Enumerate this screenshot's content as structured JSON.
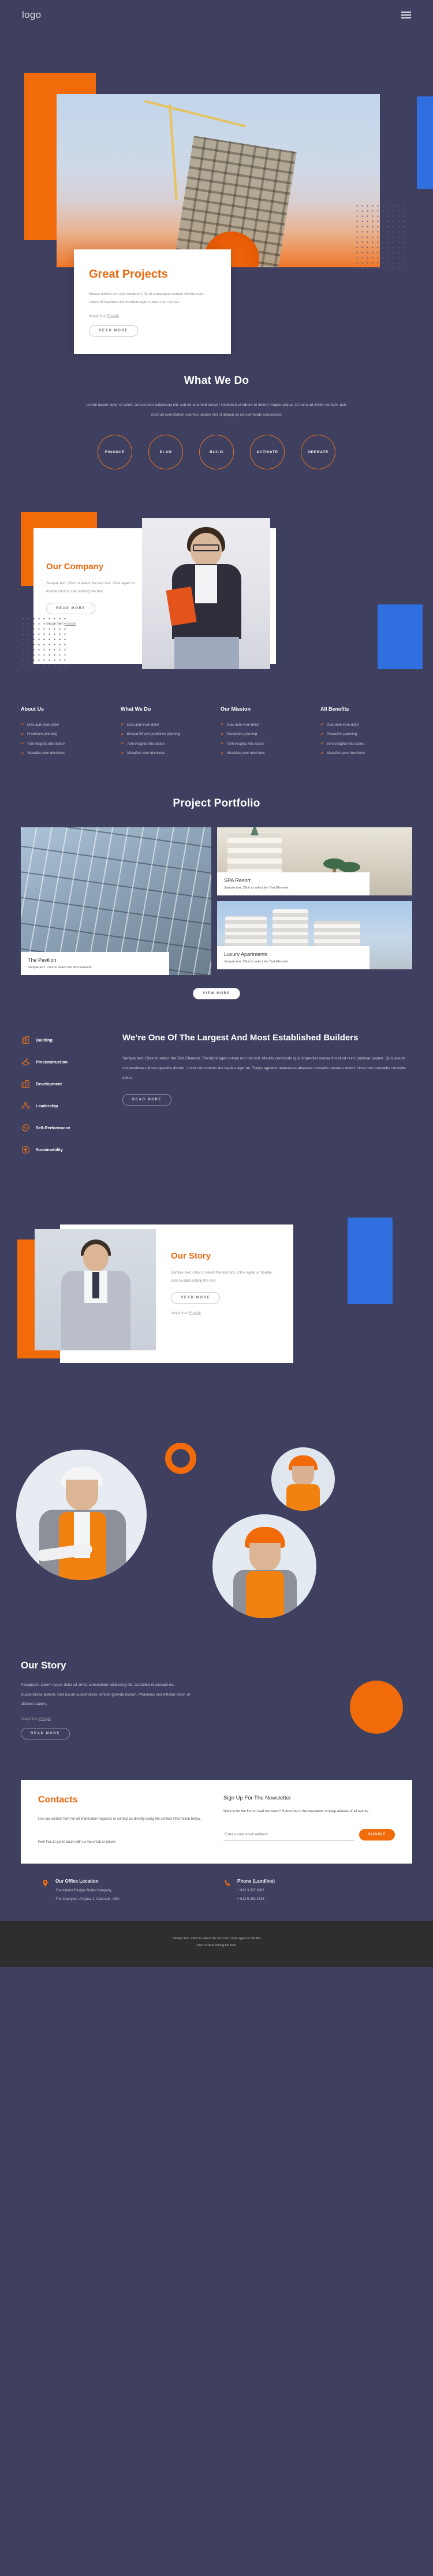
{
  "header": {
    "logo": "logo",
    "menu_icon": "hamburger-menu-icon"
  },
  "hero": {
    "title": "Great Projects",
    "body": "Massa ultricies mi quis hendrerit. Ac ut consequat semper viverra nam. Libero id faucibus nisl tincidunt eget nullam non nisi est.",
    "credit_prefix": "Image from ",
    "credit_link": "Freepik",
    "cta": "READ MORE"
  },
  "what_we_do": {
    "title": "What We Do",
    "subtitle": "Lorem ipsum dolor sit amet, consectetur adipiscing elit, sed do eiusmod tempor incididunt ut labore et dolore magna aliqua. Ut enim ad minim veniam, quis nostrud exercitation ullamco laboris nisi ut aliquip ex ea commodo consequat.",
    "steps": [
      "FINANCE",
      "PLAN",
      "BUILD",
      "ACTIVATE",
      "OPERATE"
    ]
  },
  "company": {
    "title": "Our Company",
    "body": "Sample text. Click to select the text box. Click again or double click to start editing the text.",
    "cta": "READ MORE",
    "credit_prefix": "Image from ",
    "credit_link": "Freepik"
  },
  "columns": [
    {
      "title": "About Us",
      "items": [
        "Duis aute irure dolor",
        "Predictive planning",
        "Turn insights into action",
        "Visualize your decisions"
      ]
    },
    {
      "title": "What We Do",
      "items": [
        "Duis aute irure dolor",
        "Embed BI and predictive planning",
        "Turn insights into action",
        "Visualize your decisions"
      ]
    },
    {
      "title": "Our Mission",
      "items": [
        "Duis aute irure dolor",
        "Predictive planning",
        "Turn insights into action",
        "Visualize your decisions"
      ]
    },
    {
      "title": "All Benefits",
      "items": [
        "Duis aute irure dolor",
        "Predictive planning",
        "Turn insights into action",
        "Visualize your decisions"
      ]
    }
  ],
  "portfolio": {
    "title": "Project Portfolio",
    "tiles": [
      {
        "name": "The Pavilion",
        "caption": "Sample text. Click to select the Text Element."
      },
      {
        "name": "SPA Resort",
        "caption": "Sample text. Click to select the Text Element."
      },
      {
        "name": "Luxury Apartments",
        "caption": "Sample text. Click to select the Text Element."
      }
    ],
    "cta": "VIEW MORE"
  },
  "builders": {
    "features": [
      {
        "label": "Building",
        "icon": "building-icon"
      },
      {
        "label": "Preconstruction",
        "icon": "blueprint-icon"
      },
      {
        "label": "Development",
        "icon": "city-icon"
      },
      {
        "label": "Leadership",
        "icon": "people-icon"
      },
      {
        "label": "Self-Performance",
        "icon": "gear-code-icon"
      },
      {
        "label": "Sustainability",
        "icon": "energy-leaf-icon"
      }
    ],
    "title": "We’re One Of The Largest And Most Established Builders",
    "body": "Sample text. Click to select the Text Element. Tincidunt eget nullam non nisi est. Mauris commodo quis imperdiet massa tincidunt nunc pulvinar sapien. Quis ipsum suspendisse ultrices gravida dictum. Justo nec ultrices dui sapien eget mi. Turpis egestas maecenas pharetra convallis posuere morbi. Urna duis convallis convallis tellus.",
    "cta": "READ MORE"
  },
  "story_one": {
    "title": "Our Story",
    "body": "Sample text. Click to select the text box. Click again or double click to start editing the text.",
    "cta": "READ MORE",
    "credit_prefix": "Image from ",
    "credit_link": "Freepik"
  },
  "story_two": {
    "title": "Our Story",
    "body": "Paragraph. Lorem ipsum dolor sit amet, consectetur adipiscing elit. Curabitur id suscipit ex. Suspendisse potenti. Sed ipsum suspendisse ultrices gravida dictum. Phasellus sed efficitur dolor, et ultricies sapien.",
    "credit_prefix": "Image from ",
    "credit_link": "Freepik",
    "cta": "READ MORE"
  },
  "contacts": {
    "title": "Contacts",
    "body1": "Use our contact form for all information requests or contact us directly using the contact information below.",
    "body2": "Feel free to get in touch with us via email or phone",
    "newsletter_title": "Sign Up For The Newsletter",
    "newsletter_body": "Want to be the first to read our news? Subscribe to the newsletter to keep abreast of all events.",
    "email_placeholder": "Enter a valid email address",
    "submit_label": "SUBMIT",
    "office": {
      "icon": "location-pin-icon",
      "title": "Our Office Location",
      "line1": "The Interior Design Studio Company",
      "line2": "The Courtyard, Al Quoz 1, Colorado,  USA"
    },
    "phone": {
      "icon": "phone-icon",
      "title": "Phone (Landline)",
      "line1": "+ 912 3 567 8987",
      "line2": "+ 912 5 252 3336"
    }
  },
  "footer": {
    "line1": "Sample text. Click to select the text box. Click again or double",
    "line2": "click to start editing the text."
  },
  "colors": {
    "accent": "#f26b0a",
    "background": "#3f3f5f",
    "blue": "#2f6fe0",
    "footer": "#2e2e2e"
  }
}
